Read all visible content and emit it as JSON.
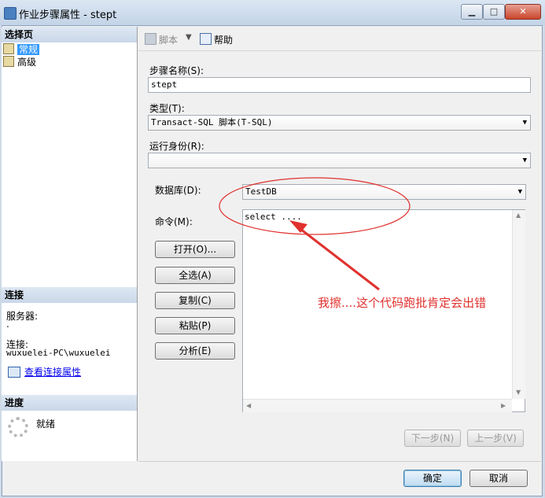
{
  "window": {
    "title": "作业步骤属性 - stept"
  },
  "left": {
    "select_page_header": "选择页",
    "pages": [
      {
        "label": "常规"
      },
      {
        "label": "高级"
      }
    ],
    "connection_header": "连接",
    "server_label": "服务器:",
    "server_value": ".",
    "connection_label": "连接:",
    "connection_value": "wuxuelei-PC\\wuxuelei",
    "view_connection_link": "查看连接属性",
    "progress_header": "进度",
    "progress_status": "就绪"
  },
  "toolbar": {
    "script_label": "脚本",
    "help_label": "帮助"
  },
  "form": {
    "step_name_label": "步骤名称(S):",
    "step_name_value": "stept",
    "type_label": "类型(T):",
    "type_value": "Transact-SQL 脚本(T-SQL)",
    "run_as_label": "运行身份(R):",
    "run_as_value": "",
    "database_label": "数据库(D):",
    "database_value": "TestDB",
    "command_label": "命令(M):",
    "command_value": "select ....",
    "buttons": {
      "open": "打开(O)...",
      "select_all": "全选(A)",
      "copy": "复制(C)",
      "paste": "粘贴(P)",
      "parse": "分析(E)"
    },
    "next_step": "下一步(N)",
    "prev_step": "上一步(V)"
  },
  "annotation": {
    "text": "我擦....这个代码跑批肯定会出错",
    "color": "#e0312e"
  },
  "footer": {
    "ok": "确定",
    "cancel": "取消"
  },
  "icons": {
    "title": "window-app-icon",
    "script": "script-icon",
    "help": "help-icon",
    "progress": "spinner-icon"
  }
}
